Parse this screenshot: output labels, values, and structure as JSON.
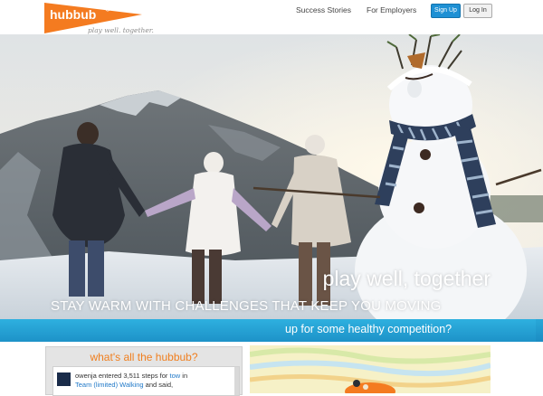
{
  "brand": {
    "logo_text": "hubbub",
    "tagline": "play well. together.",
    "accent_color": "#f47b20"
  },
  "nav": {
    "success_stories": "Success Stories",
    "for_employers": "For Employers",
    "sign_up": "Sign Up",
    "log_in": "Log In"
  },
  "hero": {
    "title": "play well, together",
    "subtitle": "STAY WARM WITH CHALLENGES THAT KEEP YOU MOVING"
  },
  "band": {
    "text": "up for some healthy competition?",
    "color": "#23a0d6"
  },
  "feed": {
    "heading": "what's all the hubbub?",
    "item": {
      "prefix": "owenja entered 3,511 steps for",
      "link1": "tow",
      "mid": "in",
      "link2": "Team (limited) Walking",
      "suffix": "and said,"
    }
  }
}
